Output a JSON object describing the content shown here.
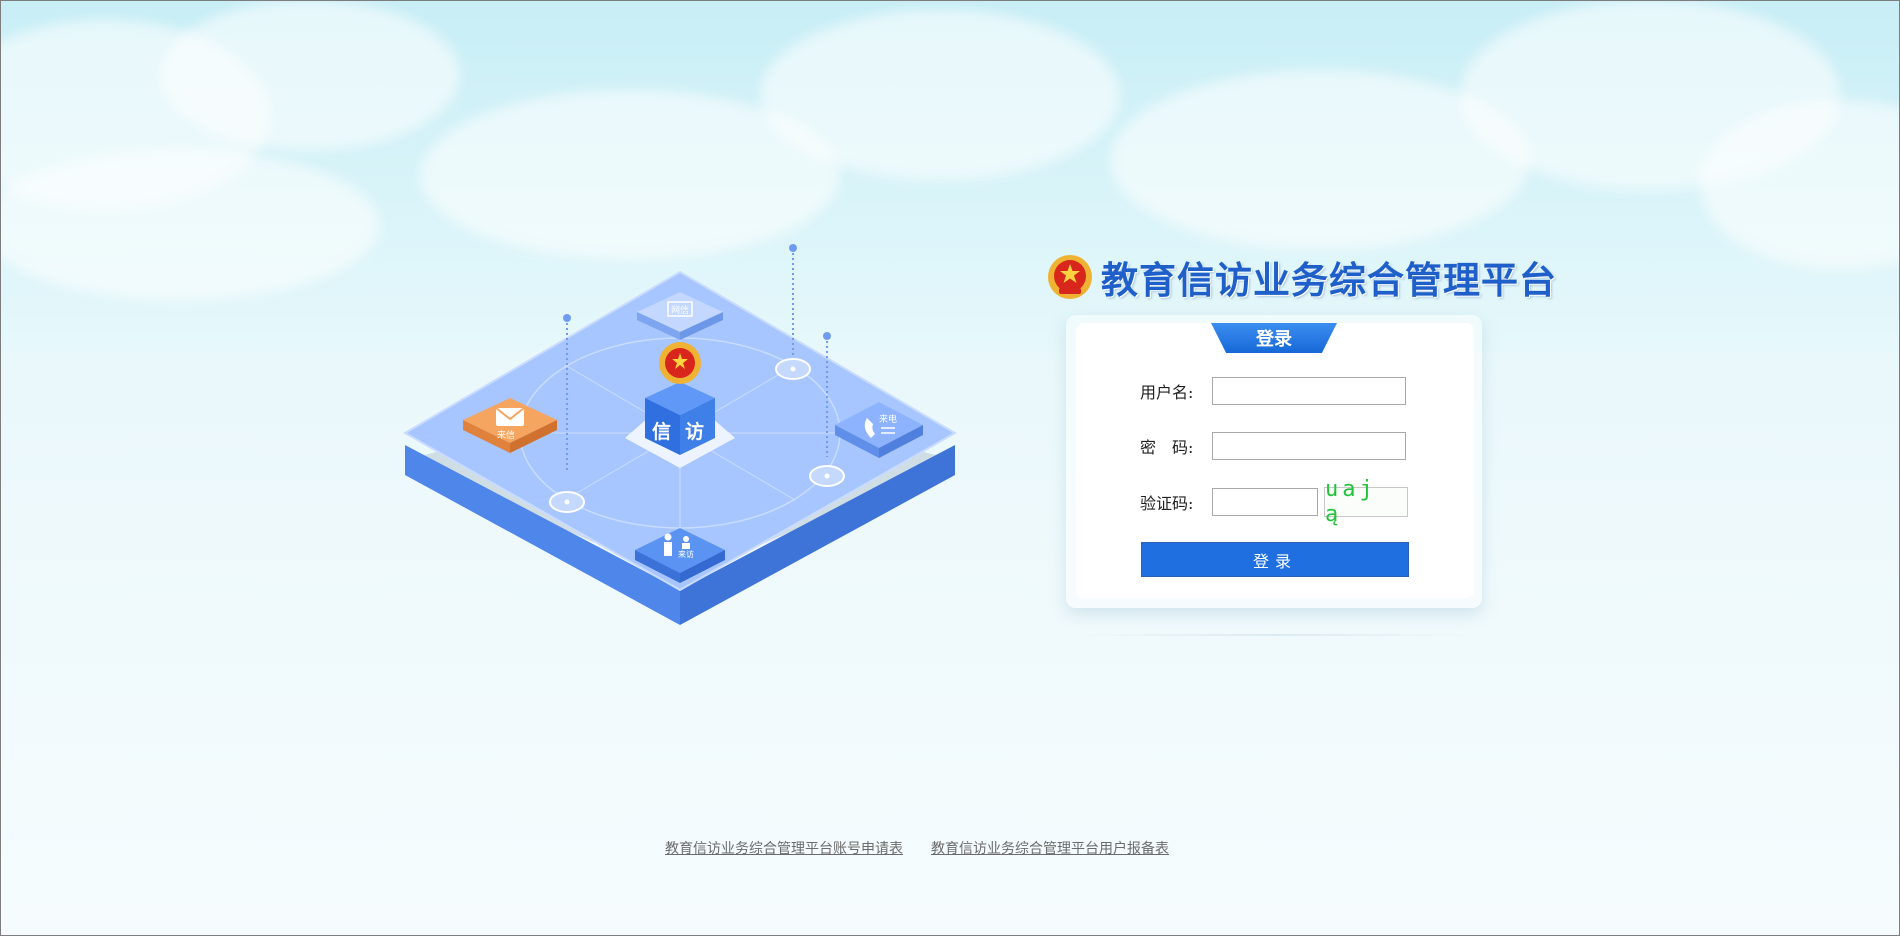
{
  "header": {
    "title": "教育信访业务综合管理平台"
  },
  "illustration": {
    "center_block_text": [
      "信",
      "访"
    ],
    "tiles": {
      "top": "网信",
      "left": "来信",
      "right": "来电",
      "bottom": "来访"
    }
  },
  "login": {
    "tab_label": "登录",
    "username_label": "用户名:",
    "password_label": "密　码:",
    "captcha_label": "验证码:",
    "username_value": "",
    "password_value": "",
    "captcha_value": "",
    "captcha_text": "uaj ą",
    "submit_label": "登录"
  },
  "footer": {
    "links": [
      "教育信访业务综合管理平台账号申请表",
      "教育信访业务综合管理平台用户报备表"
    ]
  },
  "colors": {
    "accent": "#1f6fe0",
    "title": "#1f5fc9",
    "captcha": "#22c338",
    "platform": "#8fb7ff",
    "letter_tile": "#f2a35b"
  }
}
